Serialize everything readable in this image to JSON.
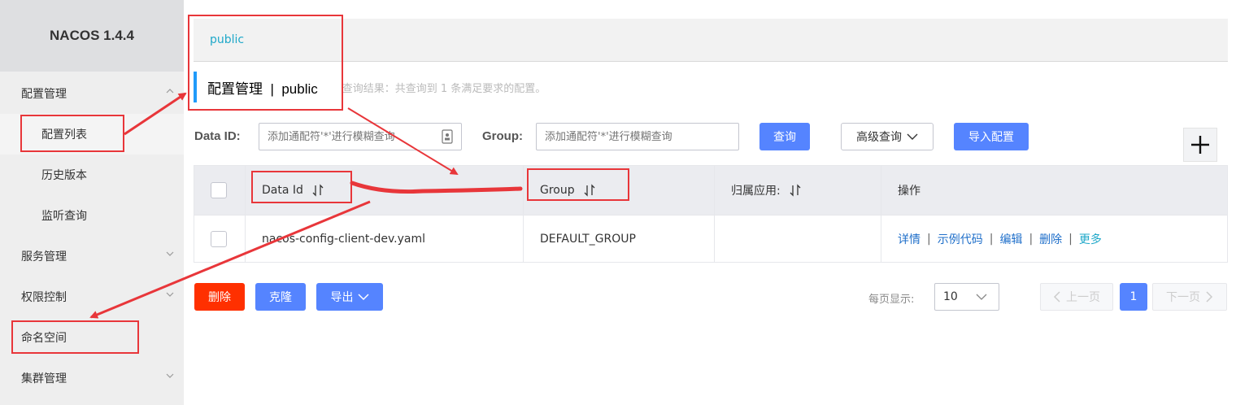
{
  "app": {
    "title": "NACOS 1.4.4"
  },
  "sidebar": {
    "groups": [
      {
        "label": "配置管理",
        "expanded": true,
        "subitems": [
          {
            "label": "配置列表",
            "active": true
          },
          {
            "label": "历史版本"
          },
          {
            "label": "监听查询"
          }
        ]
      },
      {
        "label": "服务管理",
        "expanded": false
      },
      {
        "label": "权限控制",
        "expanded": false
      },
      {
        "label": "命名空间",
        "expanded": false
      },
      {
        "label": "集群管理",
        "expanded": false
      }
    ]
  },
  "namespace_bar": {
    "label": "public"
  },
  "header": {
    "title": "配置管理",
    "separator": "|",
    "namespace": "public",
    "result_text": "查询结果：共查询到 1 条满足要求的配置。"
  },
  "filters": {
    "data_id_label": "Data ID:",
    "data_id_placeholder": "添加通配符'*'进行模糊查询",
    "group_label": "Group:",
    "group_placeholder": "添加通配符'*'进行模糊查询",
    "search_button": "查询",
    "advanced_button": "高级查询",
    "import_button": "导入配置",
    "add_symbol": "+"
  },
  "table": {
    "columns": [
      "Data Id",
      "Group",
      "归属应用:",
      "操作"
    ],
    "rows": [
      {
        "data_id": "nacos-config-client-dev.yaml",
        "group": "DEFAULT_GROUP",
        "app": "",
        "ops": [
          "详情",
          "示例代码",
          "编辑",
          "删除",
          "更多"
        ]
      }
    ]
  },
  "actions": {
    "delete": "删除",
    "clone": "克隆",
    "export": "导出"
  },
  "pagination": {
    "page_size_label": "每页显示:",
    "page_size": "10",
    "prev": "上一页",
    "current": "1",
    "next": "下一页"
  },
  "colors": {
    "primary": "#5584ff",
    "danger": "#ff3000",
    "annotation": "#e8363a",
    "link": "#1f6fca"
  }
}
